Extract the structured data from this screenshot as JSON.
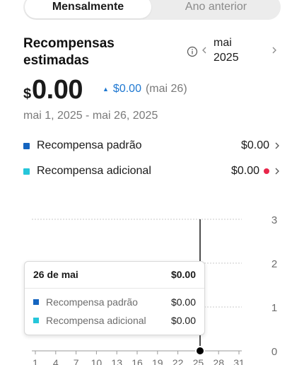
{
  "segmented": {
    "monthly_label": "Mensalmente",
    "previous_year_label": "Ano anterior"
  },
  "header": {
    "title_line1": "Recompensas",
    "title_line2": "estimadas",
    "month_line1": "mai",
    "month_line2": "2025"
  },
  "summary": {
    "currency_symbol": "$",
    "amount": "0.00",
    "delta_value": "$0.00",
    "delta_date": "(mai 26)",
    "date_range": "mai 1, 2025 - mai 26, 2025"
  },
  "legend": [
    {
      "label": "Recompensa padrão",
      "value": "$0.00",
      "color": "#1565c0",
      "alert": false
    },
    {
      "label": "Recompensa adicional",
      "value": "$0.00",
      "color": "#26c6da",
      "alert": true
    }
  ],
  "tooltip": {
    "date": "26 de mai",
    "total": "$0.00",
    "rows": [
      {
        "label": "Recompensa padrão",
        "value": "$0.00"
      },
      {
        "label": "Recompensa adicional",
        "value": "$0.00"
      }
    ]
  },
  "colors": {
    "accent_blue": "#1f78d1",
    "alert_red": "#e8264a",
    "standard_series": "#1565c0",
    "additional_series": "#26c6da"
  },
  "chart_data": {
    "type": "bar",
    "x": [
      1,
      4,
      7,
      10,
      13,
      16,
      19,
      22,
      25,
      28,
      31
    ],
    "x_tick_labels": [
      "1",
      "4",
      "7",
      "10",
      "13",
      "16",
      "19",
      "22",
      "25",
      "28",
      "31"
    ],
    "y_tick_labels": [
      "0",
      "1",
      "2",
      "3"
    ],
    "ylim": [
      0,
      3
    ],
    "series": [
      {
        "name": "Recompensa padrão",
        "values": [
          0,
          0,
          0,
          0,
          0,
          0,
          0,
          0,
          0,
          0,
          0
        ]
      },
      {
        "name": "Recompensa adicional",
        "values": [
          0,
          0,
          0,
          0,
          0,
          0,
          0,
          0,
          0,
          0,
          0
        ]
      }
    ],
    "selected_day": 26,
    "grid": true
  }
}
